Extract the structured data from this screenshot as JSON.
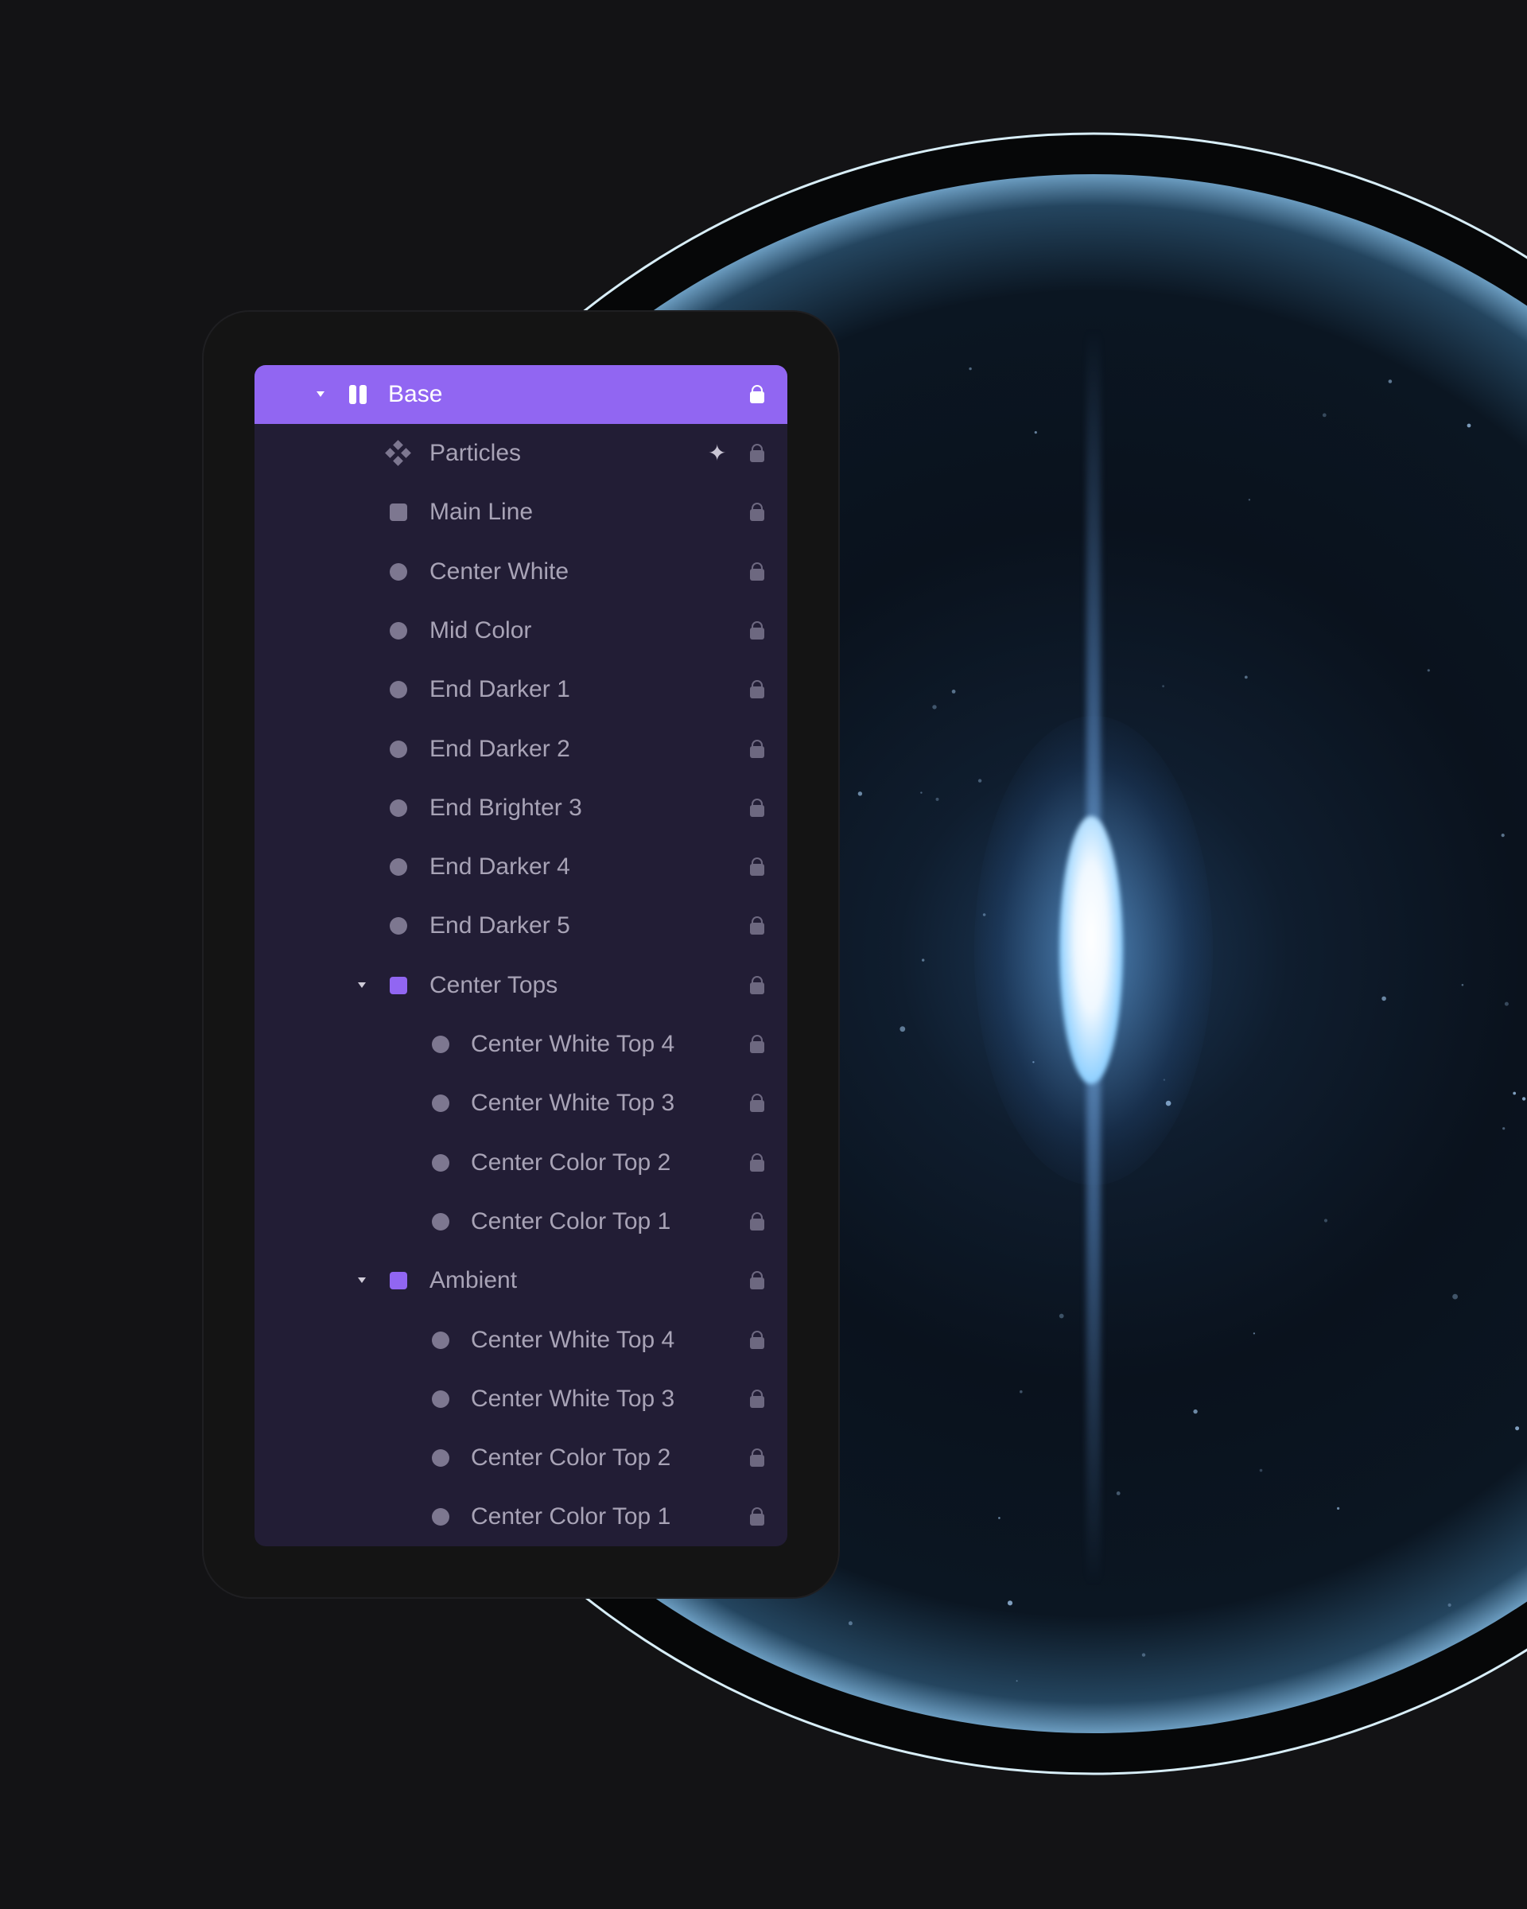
{
  "layers": {
    "header": {
      "label": "Base",
      "icon": "pause-icon",
      "expanded": true,
      "selected": true,
      "locked": true
    },
    "items": [
      {
        "label": "Particles",
        "icon": "particles-icon",
        "level": 1,
        "extra_icon": "sparkle-icon"
      },
      {
        "label": "Main Line",
        "icon": "square-icon",
        "level": 1
      },
      {
        "label": "Center White",
        "icon": "circle-icon",
        "level": 1
      },
      {
        "label": "Mid Color",
        "icon": "circle-icon",
        "level": 1
      },
      {
        "label": "End Darker 1",
        "icon": "circle-icon",
        "level": 1
      },
      {
        "label": "End Darker 2",
        "icon": "circle-icon",
        "level": 1
      },
      {
        "label": "End Brighter 3",
        "icon": "circle-icon",
        "level": 1
      },
      {
        "label": "End Darker 4",
        "icon": "circle-icon",
        "level": 1
      },
      {
        "label": "End Darker 5",
        "icon": "circle-icon",
        "level": 1
      },
      {
        "label": "Center Tops",
        "icon": "group-icon",
        "level": 1,
        "expanded": true
      },
      {
        "label": "Center White Top 4",
        "icon": "circle-icon",
        "level": 2
      },
      {
        "label": "Center White Top 3",
        "icon": "circle-icon",
        "level": 2
      },
      {
        "label": "Center Color Top 2",
        "icon": "circle-icon",
        "level": 2
      },
      {
        "label": "Center Color Top 1",
        "icon": "circle-icon",
        "level": 2
      },
      {
        "label": "Ambient",
        "icon": "group-icon",
        "level": 1,
        "expanded": true
      },
      {
        "label": "Center White Top 4",
        "icon": "circle-icon",
        "level": 2
      },
      {
        "label": "Center White Top 3",
        "icon": "circle-icon",
        "level": 2
      },
      {
        "label": "Center Color Top 2",
        "icon": "circle-icon",
        "level": 2
      },
      {
        "label": "Center Color Top 1",
        "icon": "circle-icon",
        "level": 2
      }
    ]
  },
  "colors": {
    "accent": "#9166f2",
    "panel": "#221d35",
    "background": "#131315",
    "glow": "#8fd0ff"
  }
}
